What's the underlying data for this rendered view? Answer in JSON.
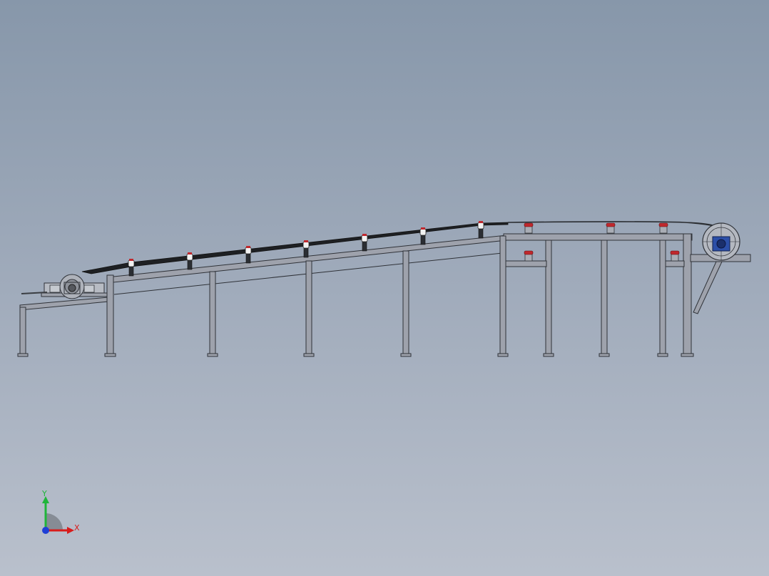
{
  "triad": {
    "x_label": "X",
    "y_label": "Y"
  },
  "colors": {
    "background_top": "#8797aa",
    "background_bottom": "#b9c0cc",
    "frame_fill": "#9ea2ac",
    "frame_edge": "#2f3238",
    "belt": "#1e2023",
    "idler_cap": "#c0282d",
    "motor_blue": "#2c4fa8",
    "axis_x": "#d81b1b",
    "axis_y": "#1fb53a",
    "axis_z": "#1f3fd6"
  }
}
